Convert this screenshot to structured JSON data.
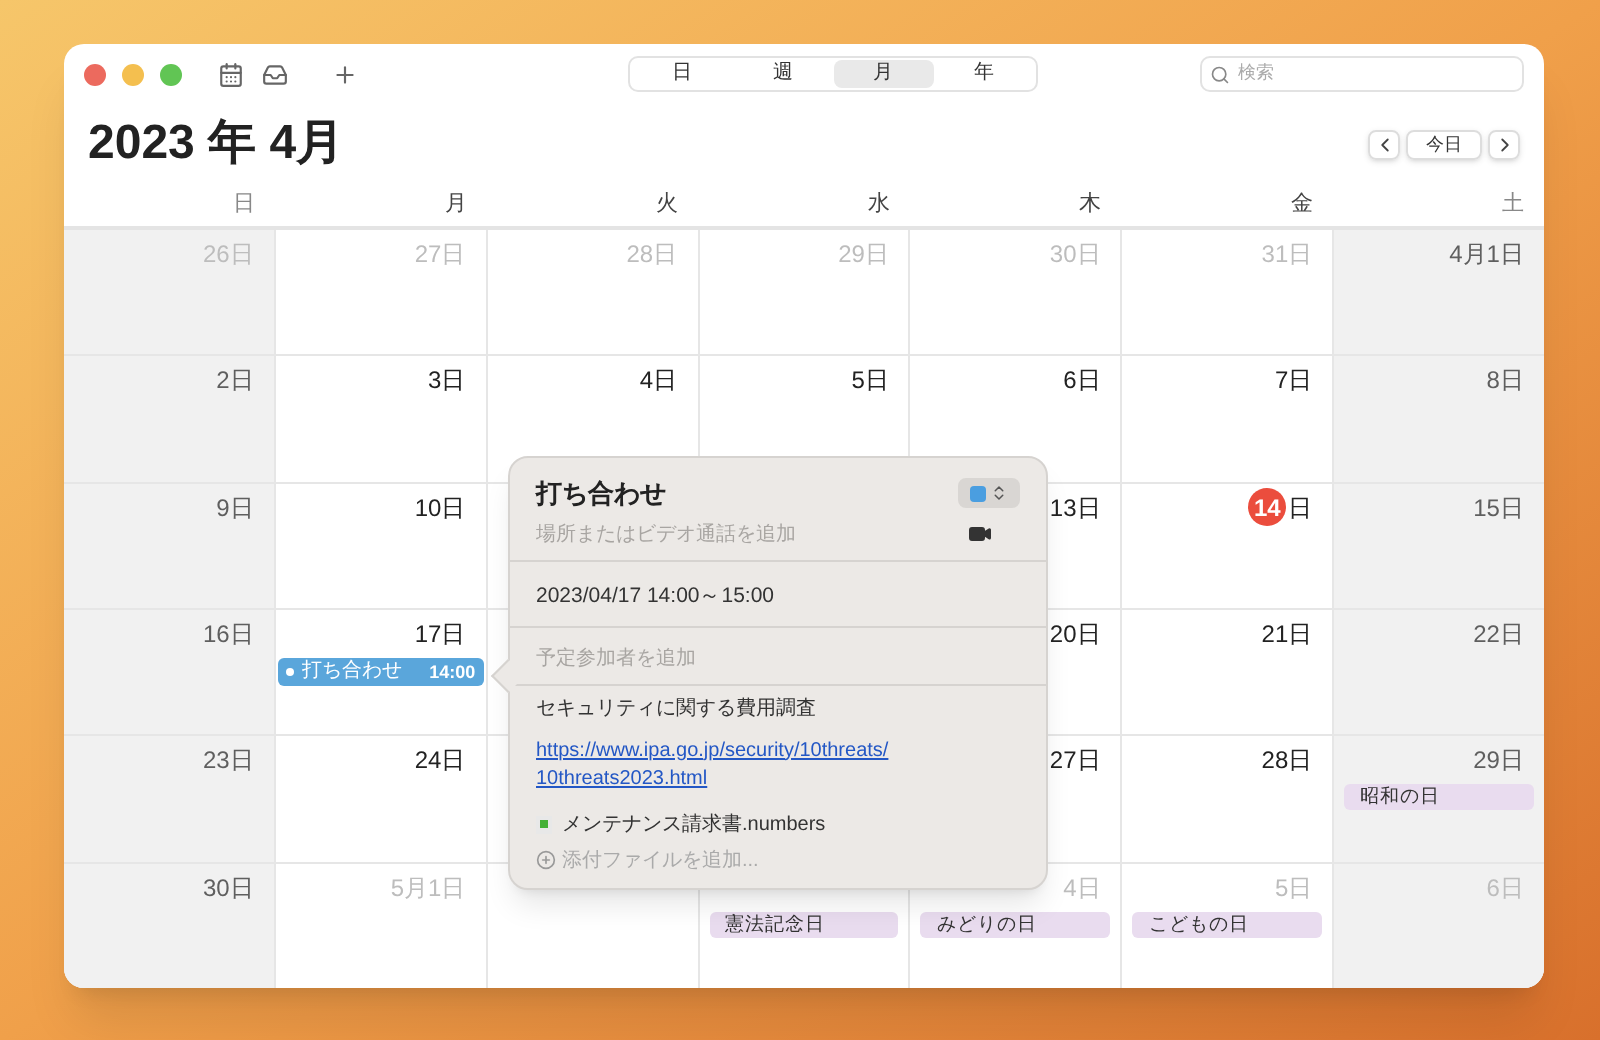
{
  "toolbar": {
    "views": [
      {
        "label": "日",
        "selected": false
      },
      {
        "label": "週",
        "selected": false
      },
      {
        "label": "月",
        "selected": true
      },
      {
        "label": "年",
        "selected": false
      }
    ],
    "search": {
      "placeholder": "検索"
    }
  },
  "header": {
    "title": "2023 年 4月",
    "today_button": "今日"
  },
  "weekdays": [
    {
      "label": "日",
      "weekend": true
    },
    {
      "label": "月",
      "weekend": false
    },
    {
      "label": "火",
      "weekend": false
    },
    {
      "label": "水",
      "weekend": false
    },
    {
      "label": "木",
      "weekend": false
    },
    {
      "label": "金",
      "weekend": false
    },
    {
      "label": "土",
      "weekend": true
    }
  ],
  "weeks": [
    {
      "left": [
        {
          "day": "26日",
          "current_month": false
        },
        {
          "day": "27日",
          "current_month": false
        },
        {
          "day": "28日",
          "current_month": false
        },
        {
          "day": "29日",
          "current_month": false
        },
        {
          "day": "30日",
          "current_month": false
        },
        {
          "day": "31日",
          "current_month": false
        },
        {
          "day": "4月1日",
          "current_month": true
        }
      ]
    },
    {
      "left": [
        {
          "day": "2日",
          "current_month": true
        },
        {
          "day": "3日",
          "current_month": true
        },
        {
          "day": "4日",
          "current_month": true
        },
        {
          "day": "5日",
          "current_month": true
        },
        {
          "day": "6日",
          "current_month": true
        },
        {
          "day": "7日",
          "current_month": true
        },
        {
          "day": "8日",
          "current_month": true
        }
      ]
    },
    {
      "left": [
        {
          "day": "9日",
          "current_month": true
        },
        {
          "day": "10日",
          "current_month": true
        }
      ],
      "right": [
        {
          "day": "13日",
          "current_month": true
        },
        {
          "day": "14",
          "unit": "日",
          "today": true
        },
        {
          "day": "15日",
          "current_month": true
        }
      ]
    },
    {
      "left": [
        {
          "day": "16日",
          "current_month": true
        },
        {
          "day": "17日",
          "current_month": true,
          "events": [
            {
              "kind": "timed",
              "title": "打ち合わせ",
              "time": "14:00",
              "selected": true,
              "color": "#5aa6db"
            }
          ]
        }
      ],
      "right": [
        {
          "day": "20日",
          "current_month": true
        },
        {
          "day": "21日",
          "current_month": true
        },
        {
          "day": "22日",
          "current_month": true
        }
      ]
    },
    {
      "left": [
        {
          "day": "23日",
          "current_month": true
        },
        {
          "day": "24日",
          "current_month": true
        }
      ],
      "right": [
        {
          "day": "27日",
          "current_month": true
        },
        {
          "day": "28日",
          "current_month": true
        },
        {
          "day": "29日",
          "current_month": true,
          "events": [
            {
              "kind": "allday",
              "title": "昭和の日",
              "selected": false,
              "color": "#e9dcef"
            }
          ]
        }
      ]
    },
    {
      "left": [
        {
          "day": "30日",
          "current_month": true
        },
        {
          "day": "5月1日",
          "current_month": false
        }
      ],
      "right": [
        {
          "events": [
            {
              "kind": "allday",
              "title": "憲法記念日",
              "selected": false,
              "color": "#e9dcef"
            }
          ]
        },
        {
          "day": "4日",
          "current_month": false,
          "events": [
            {
              "kind": "allday",
              "title": "みどりの日",
              "selected": false,
              "color": "#e9dcef"
            }
          ]
        },
        {
          "day": "5日",
          "current_month": false,
          "events": [
            {
              "kind": "allday",
              "title": "こどもの日",
              "selected": false,
              "color": "#e9dcef"
            }
          ]
        },
        {
          "day": "6日",
          "current_month": false
        }
      ]
    }
  ],
  "popover": {
    "title": "打ち合わせ",
    "calendar": {
      "color": "#4a9ee0"
    },
    "location_placeholder": "場所またはビデオ通話を追加",
    "datetime": "2023/04/17 14:00～15:00",
    "invitees_placeholder": "予定参加者を追加",
    "notes": "セキュリティに関する費用調査",
    "url_lines": [
      "https://www.ipa.go.jp/security/10threats/",
      "10threats2023.html"
    ],
    "attachment": "メンテナンス請求書.numbers",
    "add_attachment": "添付ファイルを追加..."
  }
}
